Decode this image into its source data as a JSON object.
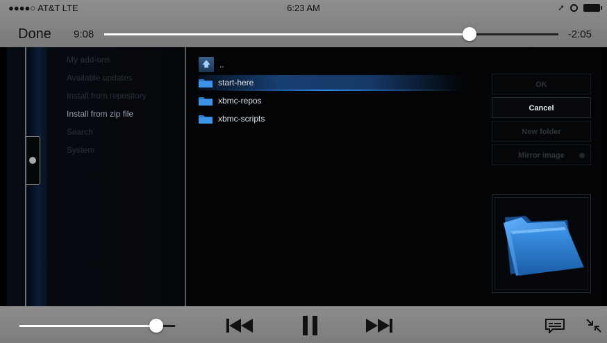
{
  "status_bar": {
    "carrier": "●●●●○ AT&T  LTE",
    "time": "6:23 AM",
    "icons": [
      "location-arrow-icon",
      "alarm-icon",
      "battery-icon"
    ]
  },
  "player": {
    "done_label": "Done",
    "elapsed": "9:08",
    "remaining": "-2:05",
    "progress": 0.805,
    "volume": 0.88,
    "controls": [
      "rewind-icon",
      "pause-icon",
      "fast-forward-icon",
      "subtitles-icon",
      "exit-fullscreen-icon"
    ]
  },
  "kodi": {
    "addon_menu": [
      {
        "label": "My add-ons",
        "active": false
      },
      {
        "label": "Available updates",
        "active": false
      },
      {
        "label": "Install from repository",
        "active": false
      },
      {
        "label": "Install from zip file",
        "active": true
      },
      {
        "label": "Search",
        "active": false
      },
      {
        "label": "System",
        "active": false
      }
    ],
    "file_browser": {
      "items": [
        {
          "label": "..",
          "icon": "up-folder-icon",
          "selected": false
        },
        {
          "label": "start-here",
          "icon": "folder-icon",
          "selected": true
        },
        {
          "label": "xbmc-repos",
          "icon": "folder-icon",
          "selected": false
        },
        {
          "label": "xbmc-scripts",
          "icon": "folder-icon",
          "selected": false
        }
      ]
    },
    "dialog_buttons": {
      "ok": "OK",
      "cancel": "Cancel",
      "new_folder": "New folder",
      "mirror_image": "Mirror image"
    },
    "preview_icon": "folder-icon"
  },
  "colors": {
    "accent_blue": "#2d8cf0",
    "folder_blue": "#2b79c9",
    "bar_gray": "#858585"
  }
}
